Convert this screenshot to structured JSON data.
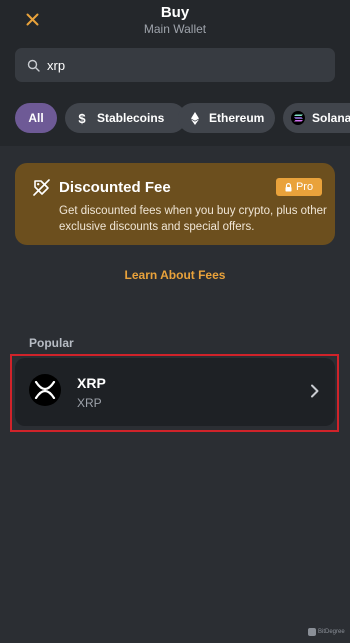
{
  "header": {
    "title": "Buy",
    "subtitle": "Main Wallet",
    "close_icon": "close-icon",
    "accent_color": "#e9a23b"
  },
  "search": {
    "value": "xrp",
    "placeholder": "",
    "icon": "search-icon"
  },
  "filters": [
    {
      "label": "All",
      "icon": "",
      "active": true
    },
    {
      "label": "Stablecoins",
      "icon": "dollar-icon",
      "active": false
    },
    {
      "label": "Ethereum",
      "icon": "ethereum-icon",
      "active": false
    },
    {
      "label": "Solana",
      "icon": "solana-icon",
      "active": false
    }
  ],
  "promo": {
    "icon": "discount-tag-icon",
    "title": "Discounted Fee",
    "badge": "Pro",
    "badge_icon": "lock-icon",
    "description": "Get discounted fees when you buy crypto, plus other exclusive discounts and special offers.",
    "background_color": "#6c4f1e"
  },
  "learn_link": "Learn About Fees",
  "popular": {
    "label": "Popular",
    "items": [
      {
        "name": "XRP",
        "ticker": "XRP",
        "icon": "xrp-icon"
      }
    ],
    "highlight_color": "#d0232a"
  },
  "watermark": "BitDegree"
}
